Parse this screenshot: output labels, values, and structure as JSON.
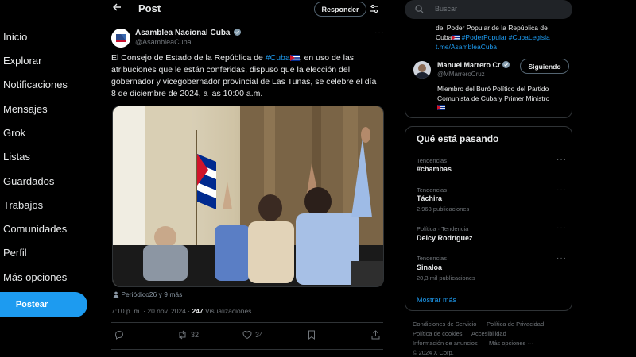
{
  "nav": {
    "items": [
      {
        "label": "Inicio"
      },
      {
        "label": "Explorar"
      },
      {
        "label": "Notificaciones"
      },
      {
        "label": "Mensajes"
      },
      {
        "label": "Grok"
      },
      {
        "label": "Listas"
      },
      {
        "label": "Guardados"
      },
      {
        "label": "Trabajos"
      },
      {
        "label": "Comunidades"
      },
      {
        "label": "Perfil"
      },
      {
        "label": "Más opciones"
      }
    ],
    "post_button": "Postear"
  },
  "header": {
    "title": "Post",
    "reply_button": "Responder"
  },
  "tweet": {
    "author_name": "Asamblea Nacional Cuba",
    "author_handle": "@AsambleaCuba",
    "text_before": "El Consejo de Estado de la República de ",
    "hashtag": "#Cuba",
    "text_after": ", en uso de las atribuciones que le están conferidas, dispuso que la elección del gobernador y vicegobernador provincial de Las Tunas, se celebre el día 8 de diciembre de 2024, a las 10:00 a.m.",
    "photo_credit": "Periódico26 y 9 más",
    "timestamp": "7:10 p. m. · 20 nov. 2024 · ",
    "views_count": "247",
    "views_label": " Visualizaciones",
    "retweets": "32",
    "likes": "34"
  },
  "search": {
    "placeholder": "Buscar"
  },
  "right_top": {
    "line1": "del Poder Popular de la República de",
    "line2_text": "Cuba",
    "line2_tags": " #PoderPopular #CubaLegisla",
    "line3": "t.me/AsambleaCuba"
  },
  "suggestion": {
    "name": "Manuel Marrero Cr",
    "handle": "@MMarreroCruz",
    "follow_button": "Siguiendo",
    "bio_line1": "Miembro del Buró Político del Partido",
    "bio_line2": "Comunista de Cuba y Primer Ministro"
  },
  "trending": {
    "title": "Qué está pasando",
    "items": [
      {
        "category": "Tendencias",
        "name": "#chambas",
        "count": ""
      },
      {
        "category": "Tendencias",
        "name": "Táchira",
        "count": "2.963 publicaciones"
      },
      {
        "category": "Política · Tendencia",
        "name": "Delcy Rodríguez",
        "count": ""
      },
      {
        "category": "Tendencias",
        "name": "Sinaloa",
        "count": "20,3 mil publicaciones"
      }
    ],
    "show_more": "Mostrar más"
  },
  "footer": {
    "links": [
      "Condiciones de Servicio",
      "Política de Privacidad",
      "Política de cookies",
      "Accesibilidad",
      "Información de anuncios",
      "Más opciones ···",
      "© 2024 X Corp."
    ]
  },
  "colors": {
    "accent": "#1d9bf0",
    "background": "#000000",
    "text": "#e7e9ea",
    "muted": "#71767b"
  }
}
